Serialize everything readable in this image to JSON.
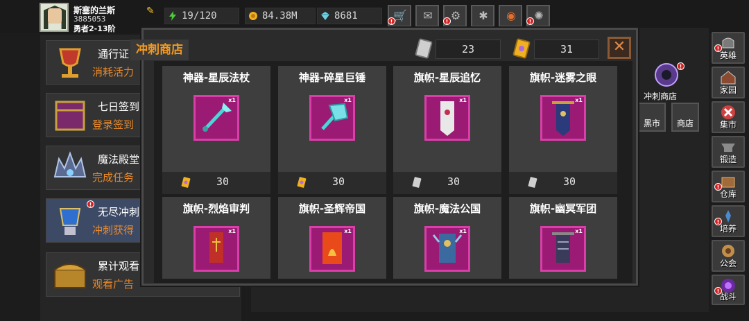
{
  "player": {
    "name": "斯塞的兰斯",
    "id": "3885053",
    "rank": "勇者2-13阶"
  },
  "resources": {
    "stamina": "19/120",
    "gold": "84.38M",
    "gems": "8681"
  },
  "left_list": {
    "items": [
      {
        "title": "通行证",
        "subtitle": "消耗活力"
      },
      {
        "title": "七日签到",
        "subtitle": "登录签到"
      },
      {
        "title": "魔法殿堂",
        "subtitle": "完成任务"
      },
      {
        "title": "无尽冲刺",
        "subtitle": "冲刺获得"
      },
      {
        "title": "累计观看",
        "subtitle": "观看广告"
      }
    ]
  },
  "background": {
    "shop_label": "冲刺商店",
    "black_market": "黑市",
    "store": "商店"
  },
  "sidebar": {
    "items": [
      {
        "label": "英雄",
        "icon": "helmet-icon"
      },
      {
        "label": "家园",
        "icon": "house-icon"
      },
      {
        "label": "集市",
        "icon": "market-icon"
      },
      {
        "label": "锻造",
        "icon": "anvil-icon"
      },
      {
        "label": "仓库",
        "icon": "warehouse-icon"
      },
      {
        "label": "培养",
        "icon": "training-icon"
      },
      {
        "label": "公会",
        "icon": "guild-icon"
      },
      {
        "label": "战斗",
        "icon": "portal-icon"
      }
    ]
  },
  "shop": {
    "title": "冲刺商店",
    "currency_silver": "23",
    "currency_gold": "31",
    "close_icon": "close-icon",
    "rows": [
      [
        {
          "name": "神器-星辰法杖",
          "price": "30",
          "currency": "gold-card",
          "qty": "x1"
        },
        {
          "name": "神器-碎星巨锤",
          "price": "30",
          "currency": "gold-card",
          "qty": "x1"
        },
        {
          "name": "旗帜-星辰追忆",
          "price": "30",
          "currency": "silver-card",
          "qty": "x1"
        },
        {
          "name": "旗帜-迷雾之眼",
          "price": "30",
          "currency": "silver-card",
          "qty": "x1"
        }
      ],
      [
        {
          "name": "旗帜-烈焰审判",
          "qty": "x1"
        },
        {
          "name": "旗帜-圣辉帝国",
          "qty": "x1"
        },
        {
          "name": "旗帜-魔法公国",
          "qty": "x1"
        },
        {
          "name": "旗帜-幽冥军团",
          "qty": "x1"
        }
      ]
    ]
  },
  "colors": {
    "accent_orange": "#f39a1e",
    "item_bg": "#9b1a74",
    "item_border": "#d93fa8",
    "alert_red": "#d42020"
  }
}
